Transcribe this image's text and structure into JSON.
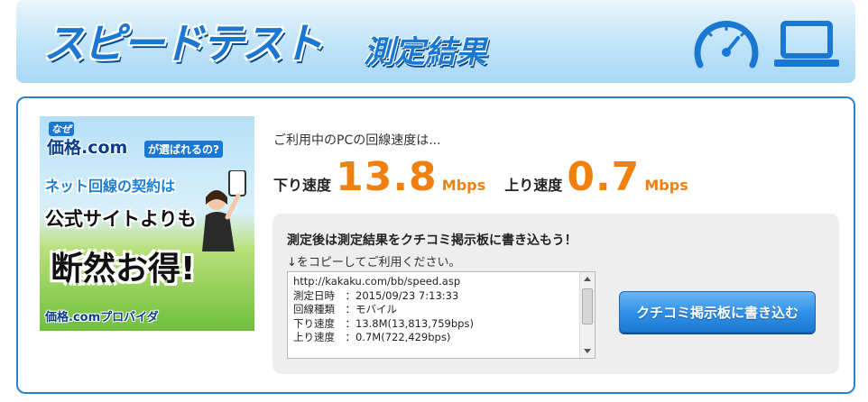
{
  "header": {
    "title": "スピードテスト",
    "subtitle": "測定結果",
    "icons": [
      "speedometer-icon",
      "laptop-icon"
    ]
  },
  "ad": {
    "why": "なぜ",
    "kakaku": "価格.com",
    "question": "が選ばれるの?",
    "line1": "ネット回線の契約は",
    "line2": "公式サイトよりも",
    "line3": "断然お得!",
    "provider": "価格.comプロバイダ"
  },
  "result": {
    "intro": "ご利用中のPCの回線速度は...",
    "download_label": "下り速度",
    "download_value": "13.8",
    "download_unit": "Mbps",
    "upload_label": "上り速度",
    "upload_value": "0.7",
    "upload_unit": "Mbps"
  },
  "post": {
    "heading": "測定後は測定結果をクチコミ掲示板に書き込もう！",
    "note": "↓をコピーしてご利用ください。",
    "lines": [
      "http://kakaku.com/bb/speed.asp",
      "測定日時　：2015/09/23 7:13:33",
      "回線種類　：モバイル",
      "下り速度　：13.8M(13,813,759bps)",
      "上り速度　：0.7M(722,429bps)"
    ],
    "button_label": "クチコミ掲示板に書き込む"
  },
  "colors": {
    "accent_blue": "#1a78d2",
    "speed_orange": "#f2800f",
    "panel_border": "#2f7fd1"
  }
}
